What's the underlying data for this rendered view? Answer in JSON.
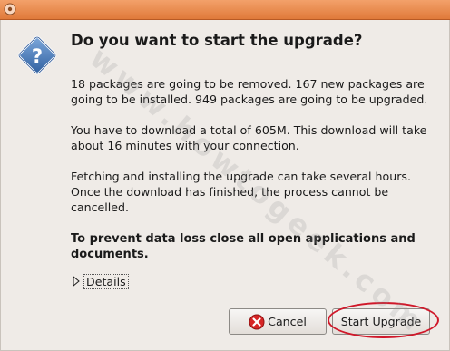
{
  "dialog": {
    "heading": "Do you want to start the upgrade?",
    "paragraph_1": "18 packages are going to be removed. 167 new packages are going to be installed. 949 packages are going to be upgraded.",
    "paragraph_2": "You have to download a total of 605M. This download will take about 16 minutes with your connection.",
    "paragraph_3": "Fetching and installing the upgrade can take several hours. Once the download has finished, the process cannot be cancelled.",
    "warning": "To prevent data loss close all open applications and documents.",
    "details_label": "Details",
    "details_expanded": false
  },
  "buttons": {
    "cancel_mnemonic": "C",
    "cancel_rest": "ancel",
    "start_mnemonic": "S",
    "start_rest": "tart Upgrade"
  },
  "watermark": "www.howtogeek.com",
  "colors": {
    "titlebar": "#e58c52",
    "dialog_bg": "#efebe7",
    "highlight_ring": "#d0182a",
    "question_icon": "#3a6fb0",
    "cancel_icon": "#cc1f1f"
  },
  "icons": {
    "window_menu": "window-menu-icon",
    "dialog": "question-icon",
    "details_toggle": "triangle-right-icon",
    "cancel": "cancel-icon"
  }
}
